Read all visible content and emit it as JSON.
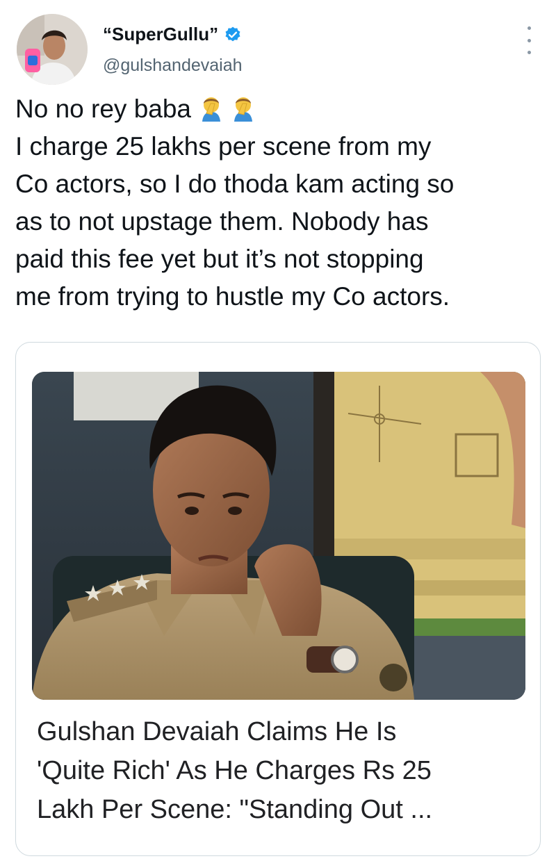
{
  "tweet": {
    "display_name": "“SuperGullu”",
    "handle": "@gulshandevaiah",
    "verified": true,
    "icons": {
      "verified": "verified-badge-icon",
      "more": "more-options-icon",
      "emoji": "person-facepalming-emoji"
    },
    "colors": {
      "verified_blue": "#1d9bf0",
      "handle_gray": "#536471"
    },
    "text_lines": [
      "No no rey baba",
      "I charge 25 lakhs per scene from my",
      "Co actors, so I do thoda kam acting so",
      "as to not upstage them. Nobody has",
      "paid this fee yet but it’s not stopping",
      "me from trying to hustle my Co actors."
    ]
  },
  "card": {
    "title_lines": [
      "Gulshan Devaiah Claims He Is",
      "'Quite Rich' As He Charges Rs 25",
      "Lakh Per Scene: \"Standing Out ..."
    ]
  }
}
